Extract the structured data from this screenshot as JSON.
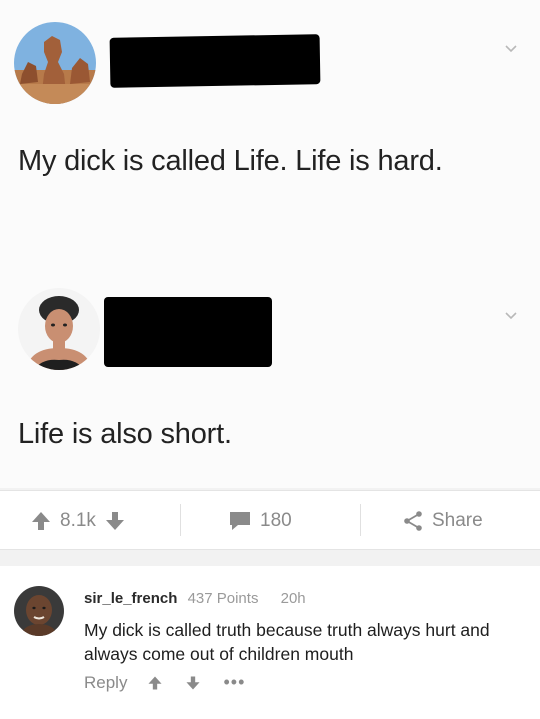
{
  "tweets": [
    {
      "text": "My dick is called Life. Life is hard.",
      "avatar_icon": "desert-rock-avatar-icon"
    },
    {
      "text": "Life is also short.",
      "avatar_icon": "woman-avatar-icon"
    }
  ],
  "actions": {
    "upvote_icon": "arrow-up-icon",
    "score": "8.1k",
    "downvote_icon": "arrow-down-icon",
    "comment_icon": "comment-bubble-icon",
    "comments": "180",
    "share_icon": "share-icon",
    "share": "Share"
  },
  "comment": {
    "username": "sir_le_french",
    "points": "437 Points",
    "age": "20h",
    "body": "My dick is called truth because truth always hurt and always come out of children mouth",
    "reply": "Reply",
    "more": "•••"
  },
  "colors": {
    "panel": "#fbfbfb",
    "text": "#222222",
    "muted": "#8a8a8a",
    "redaction": "#000000"
  }
}
